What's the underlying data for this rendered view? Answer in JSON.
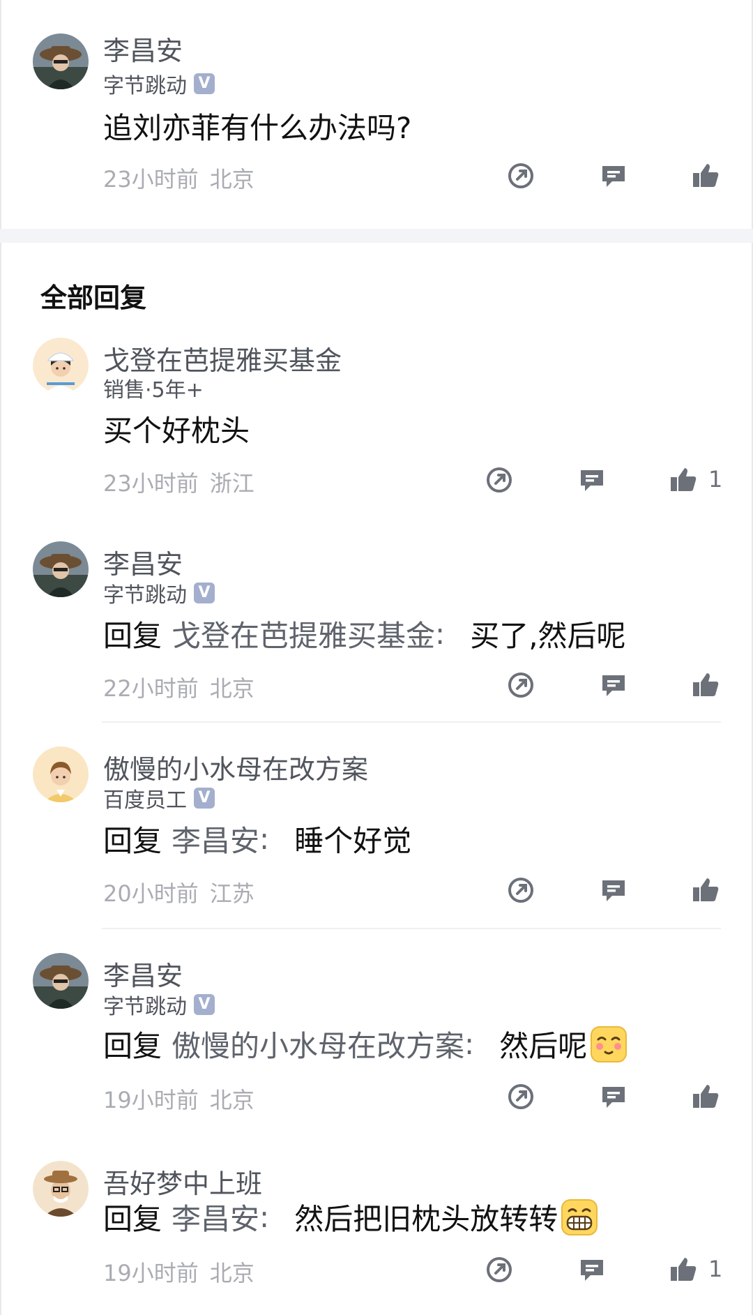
{
  "main_comment": {
    "name": "李昌安",
    "company": "字节跳动",
    "verified_badge": "V",
    "text": "追刘亦菲有什么办法吗?",
    "time": "23小时前",
    "location": "北京"
  },
  "replies_section": {
    "title": "全部回复"
  },
  "replies": [
    {
      "name": "戈登在芭提雅买基金",
      "subtitle": "销售·5年+",
      "text": "买个好枕头",
      "time": "23小时前",
      "location": "浙江",
      "likes": "1"
    },
    {
      "name": "李昌安",
      "subtitle": "字节跳动",
      "verified_badge": "V",
      "reply_keyword": "回复",
      "reply_to": "戈登在芭提雅买基金",
      "reply_colon": ":",
      "text": "买了,然后呢",
      "time": "22小时前",
      "location": "北京"
    },
    {
      "name": "傲慢的小水母在改方案",
      "subtitle": "百度员工",
      "verified_badge": "V",
      "reply_keyword": "回复",
      "reply_to": "李昌安",
      "reply_colon": ":",
      "text": "睡个好觉",
      "time": "20小时前",
      "location": "江苏"
    },
    {
      "name": "李昌安",
      "subtitle": "字节跳动",
      "verified_badge": "V",
      "reply_keyword": "回复",
      "reply_to": "傲慢的小水母在改方案",
      "reply_colon": ":",
      "text": "然后呢",
      "emoji": "blush-emoji",
      "time": "19小时前",
      "location": "北京"
    },
    {
      "name": "吾好梦中上班",
      "reply_keyword": "回复",
      "reply_to": "李昌安",
      "reply_colon": ":",
      "text": "然后把旧枕头放转转",
      "emoji": "grin-emoji",
      "time": "19小时前",
      "location": "北京",
      "likes": "1"
    }
  ],
  "icons": {
    "share": "share-icon",
    "comment": "comment-icon",
    "like": "thumbs-up-icon"
  },
  "colors": {
    "name": "#50545c",
    "meta": "#a9acb2",
    "icon": "#6c7079",
    "badge": "#a4afce"
  }
}
